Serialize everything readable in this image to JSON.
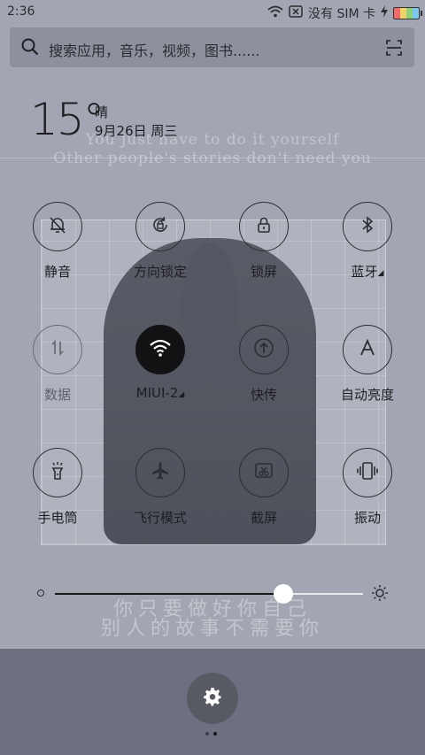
{
  "status_bar": {
    "time": "2:36",
    "carrier_text": "没有 SIM 卡",
    "icons": [
      "wifi-icon",
      "no-sim-icon",
      "charging-icon",
      "battery-icon"
    ]
  },
  "search": {
    "placeholder": "搜索应用，音乐，视频，图书......",
    "icons": [
      "search-icon",
      "scan-icon"
    ]
  },
  "weather": {
    "temperature": "15°",
    "condition": "晴",
    "date": "9月26日 周三"
  },
  "wallpaper_quotes": {
    "en_line1": "You just have to do it yourself",
    "en_line2": "Other people's stories don't need you",
    "cn_line1": "你只要做好你自己",
    "cn_line2": "别人的故事不需要你"
  },
  "toggles": [
    {
      "label": "静音",
      "icon": "mute-bell-icon",
      "state": "off"
    },
    {
      "label": "方向锁定",
      "icon": "rotation-lock-icon",
      "state": "off"
    },
    {
      "label": "锁屏",
      "icon": "lock-icon",
      "state": "off"
    },
    {
      "label": "蓝牙",
      "icon": "bluetooth-icon",
      "state": "off",
      "has_more": true
    },
    {
      "label": "数据",
      "icon": "mobile-data-icon",
      "state": "disabled"
    },
    {
      "label": "MIUI-2",
      "icon": "wifi-icon",
      "state": "on",
      "has_more": true
    },
    {
      "label": "快传",
      "icon": "quick-transfer-icon",
      "state": "off"
    },
    {
      "label": "自动亮度",
      "icon": "auto-brightness-icon",
      "state": "off"
    },
    {
      "label": "手电筒",
      "icon": "flashlight-icon",
      "state": "off"
    },
    {
      "label": "飞行模式",
      "icon": "airplane-icon",
      "state": "off"
    },
    {
      "label": "截屏",
      "icon": "screenshot-icon",
      "state": "off"
    },
    {
      "label": "振动",
      "icon": "vibrate-icon",
      "state": "off"
    }
  ],
  "brightness": {
    "level": 0.74,
    "icons": [
      "brightness-low-icon",
      "brightness-high-icon"
    ]
  },
  "settings": {
    "icon": "gear-icon"
  },
  "pager": {
    "count": 2,
    "active": 1
  },
  "colors": {
    "panel": "#a3a6b2",
    "active_toggle": "#121214",
    "text": "#1e1e22",
    "slider_thumb": "#ffffff"
  }
}
